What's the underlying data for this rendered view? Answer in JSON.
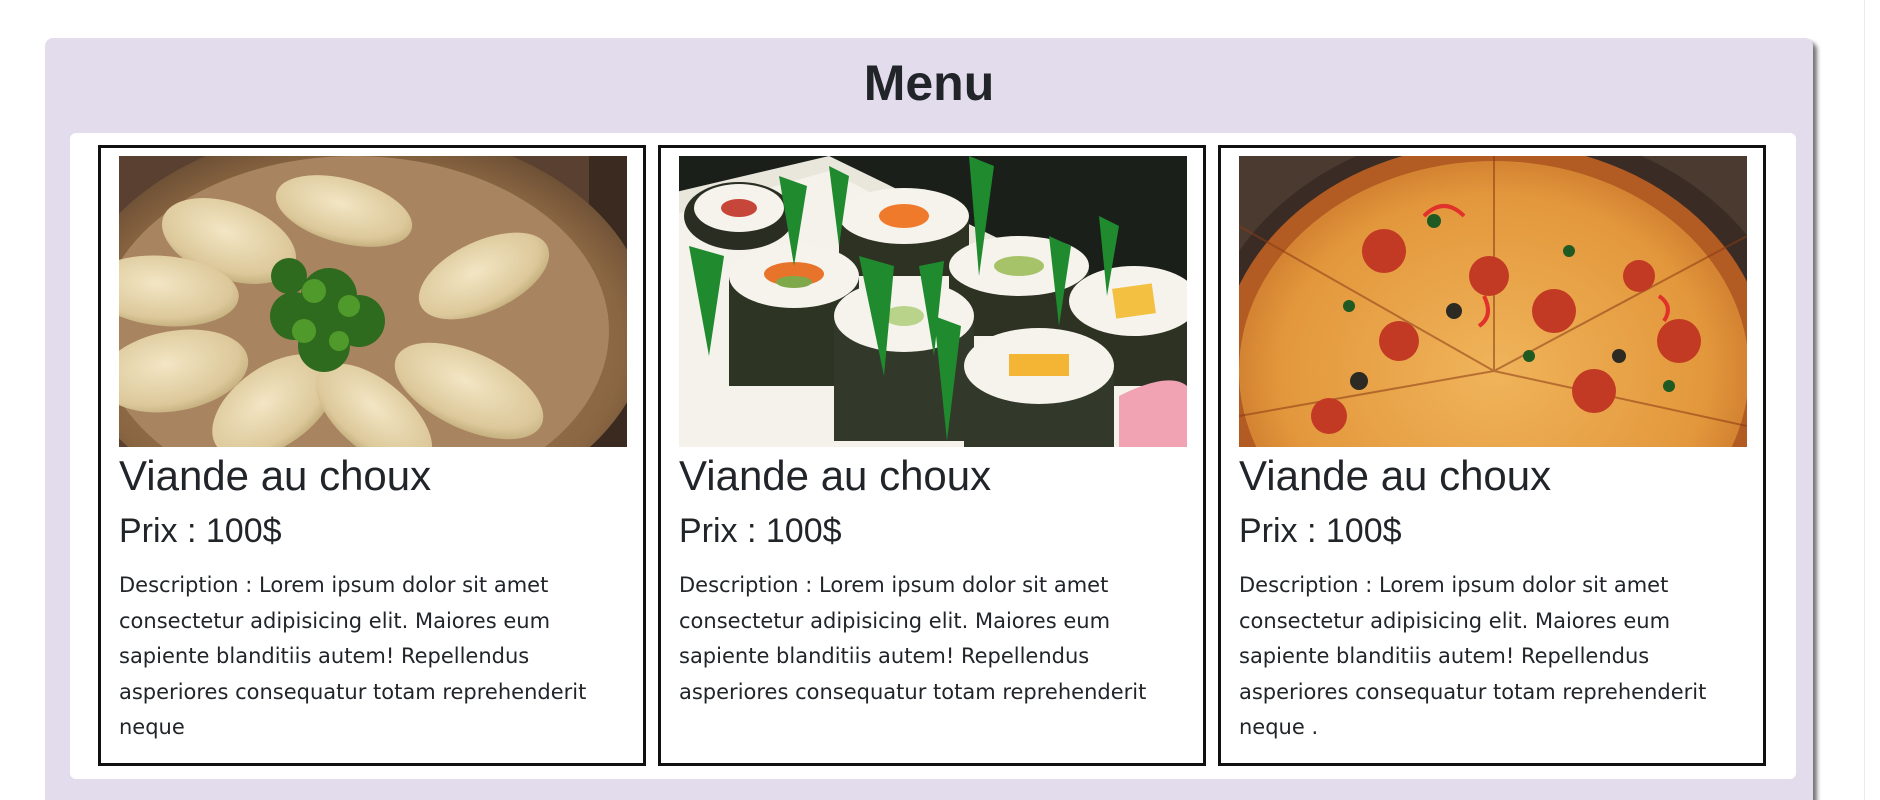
{
  "menu": {
    "title": "Menu",
    "cards": [
      {
        "name": "Viande au choux",
        "price": "Prix : 100$",
        "description": "Description : Lorem ipsum dolor sit amet consectetur adipisicing elit. Maiores eum sapiente blanditiis autem! Repellendus asperiores consequatur totam reprehenderit neque",
        "image_subject": "dumplings"
      },
      {
        "name": "Viande au choux",
        "price": "Prix : 100$",
        "description": "Description : Lorem ipsum dolor sit amet consectetur adipisicing elit. Maiores eum sapiente blanditiis autem! Repellendus asperiores consequatur totam reprehenderit",
        "image_subject": "sushi"
      },
      {
        "name": "Viande au choux",
        "price": "Prix : 100$",
        "description": "Description : Lorem ipsum dolor sit amet consectetur adipisicing elit. Maiores eum sapiente blanditiis autem! Repellendus asperiores consequatur totam reprehenderit neque .",
        "image_subject": "pizza"
      }
    ]
  },
  "colors": {
    "panel_background": "#e3dcec",
    "card_border": "#111111",
    "text": "#212529"
  }
}
